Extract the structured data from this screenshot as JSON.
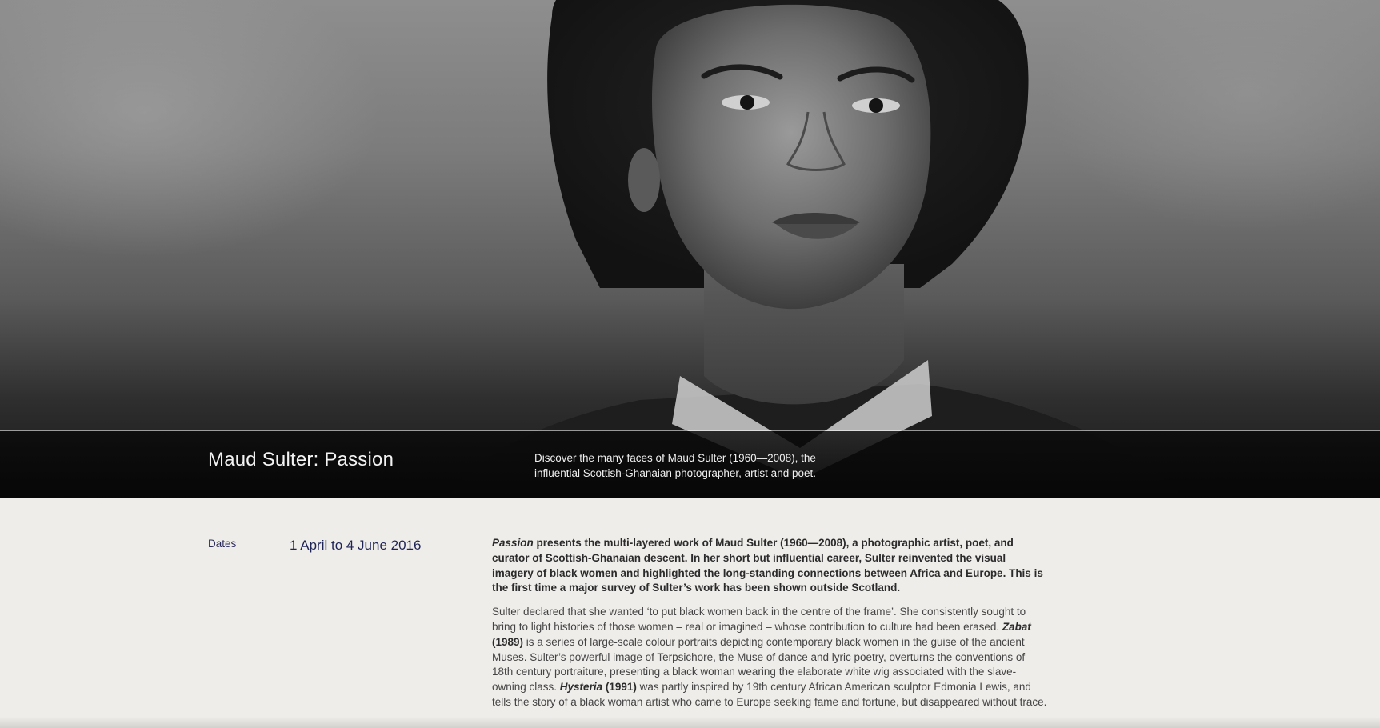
{
  "hero": {
    "image_alt": "Black and white portrait of Maud Sulter",
    "title": "Maud Sulter: Passion",
    "description": "Discover the many faces of Maud Sulter (1960—2008), the influential Scottish-Ghanaian photographer, artist and poet."
  },
  "details": {
    "dates_label": "Dates",
    "dates_value": "1 April to 4 June 2016"
  },
  "body": {
    "intro_em": "Passion",
    "intro_rest": " presents the multi-layered work of Maud Sulter (1960—2008), a photographic artist, poet, and curator of Scottish-Ghanaian descent. In her short but influential career, Sulter reinvented the visual imagery of black women and highlighted the long-standing connections between Africa and Europe. This is the first time a major survey of Sulter’s work has been shown outside Scotland.",
    "p2_part1": "Sulter declared that she wanted ‘to put black women back in the centre of the frame’. She consistently sought to bring to light histories of those women – real or imagined – whose contribution to culture had been erased. ",
    "p2_zabat": "Zabat",
    "p2_zabat_year": " (1989)",
    "p2_part2": " is a series of large-scale colour portraits depicting contemporary black women in the guise of the ancient Muses. Sulter’s powerful image of Terpsichore, the Muse of dance and lyric poetry, overturns the conventions of 18th century portraiture, presenting a black woman wearing the elaborate white wig associated with the slave-owning class. ",
    "p2_hysteria": "Hysteria",
    "p2_hysteria_year": " (1991)",
    "p2_part3": " was partly inspired by 19th century African American sculptor Edmonia Lewis, and tells the story of a black woman artist who came to Europe seeking fame and fortune, but disappeared without trace."
  },
  "colors": {
    "page_bg": "#efedea",
    "title_band": "#0a0a0a",
    "dates_text": "#1f2457"
  }
}
